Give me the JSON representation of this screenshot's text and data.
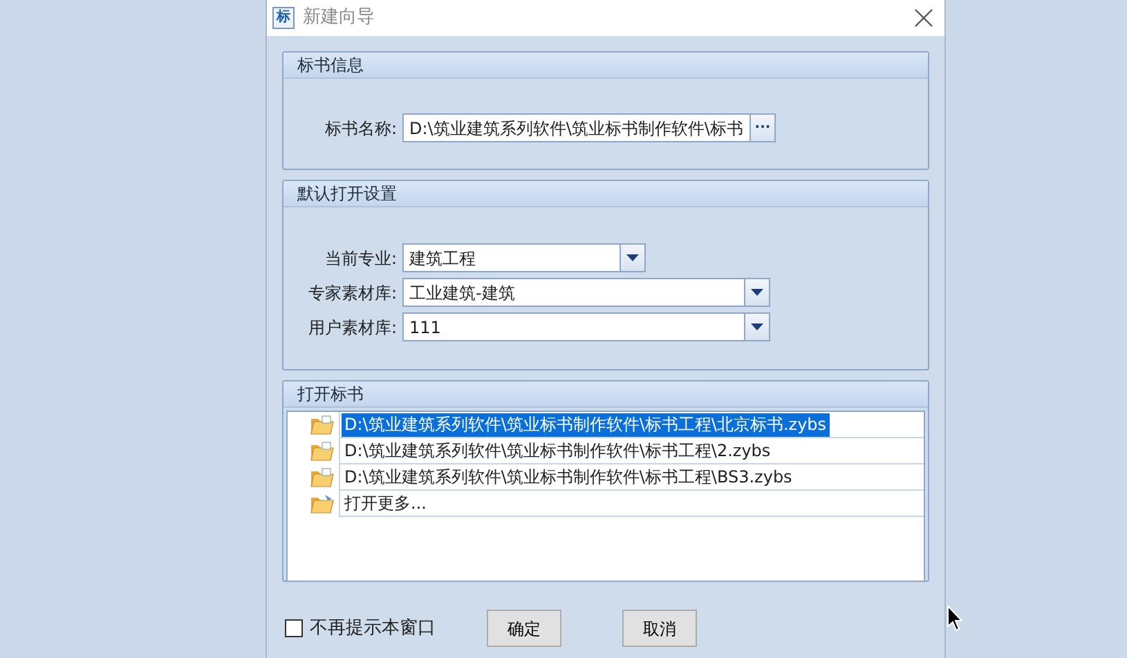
{
  "window": {
    "icon_text": "标",
    "title": "新建向导"
  },
  "bid_info": {
    "title": "标书信息",
    "name_label": "标书名称:",
    "name_value": "D:\\筑业建筑系列软件\\筑业标书制作软件\\标书",
    "browse_button": "···"
  },
  "default_settings": {
    "title": "默认打开设置",
    "fields": [
      {
        "label": "当前专业:",
        "value": "建筑工程",
        "kind": "short"
      },
      {
        "label": "专家素材库:",
        "value": "工业建筑-建筑",
        "kind": "wide"
      },
      {
        "label": "用户素材库:",
        "value": "111",
        "kind": "wide"
      }
    ]
  },
  "open_bid": {
    "title": "打开标书",
    "items": [
      {
        "text": "D:\\筑业建筑系列软件\\筑业标书制作软件\\标书工程\\北京标书.zybs",
        "kind": "file",
        "selected": true
      },
      {
        "text": "D:\\筑业建筑系列软件\\筑业标书制作软件\\标书工程\\2.zybs",
        "kind": "file",
        "selected": false
      },
      {
        "text": "D:\\筑业建筑系列软件\\筑业标书制作软件\\标书工程\\BS3.zybs",
        "kind": "file",
        "selected": false
      },
      {
        "text": "打开更多...",
        "kind": "more",
        "selected": false
      }
    ]
  },
  "footer": {
    "checkbox": {
      "label": "不再提示本窗口",
      "checked": false
    },
    "buttons": [
      "确定",
      "取消"
    ]
  }
}
